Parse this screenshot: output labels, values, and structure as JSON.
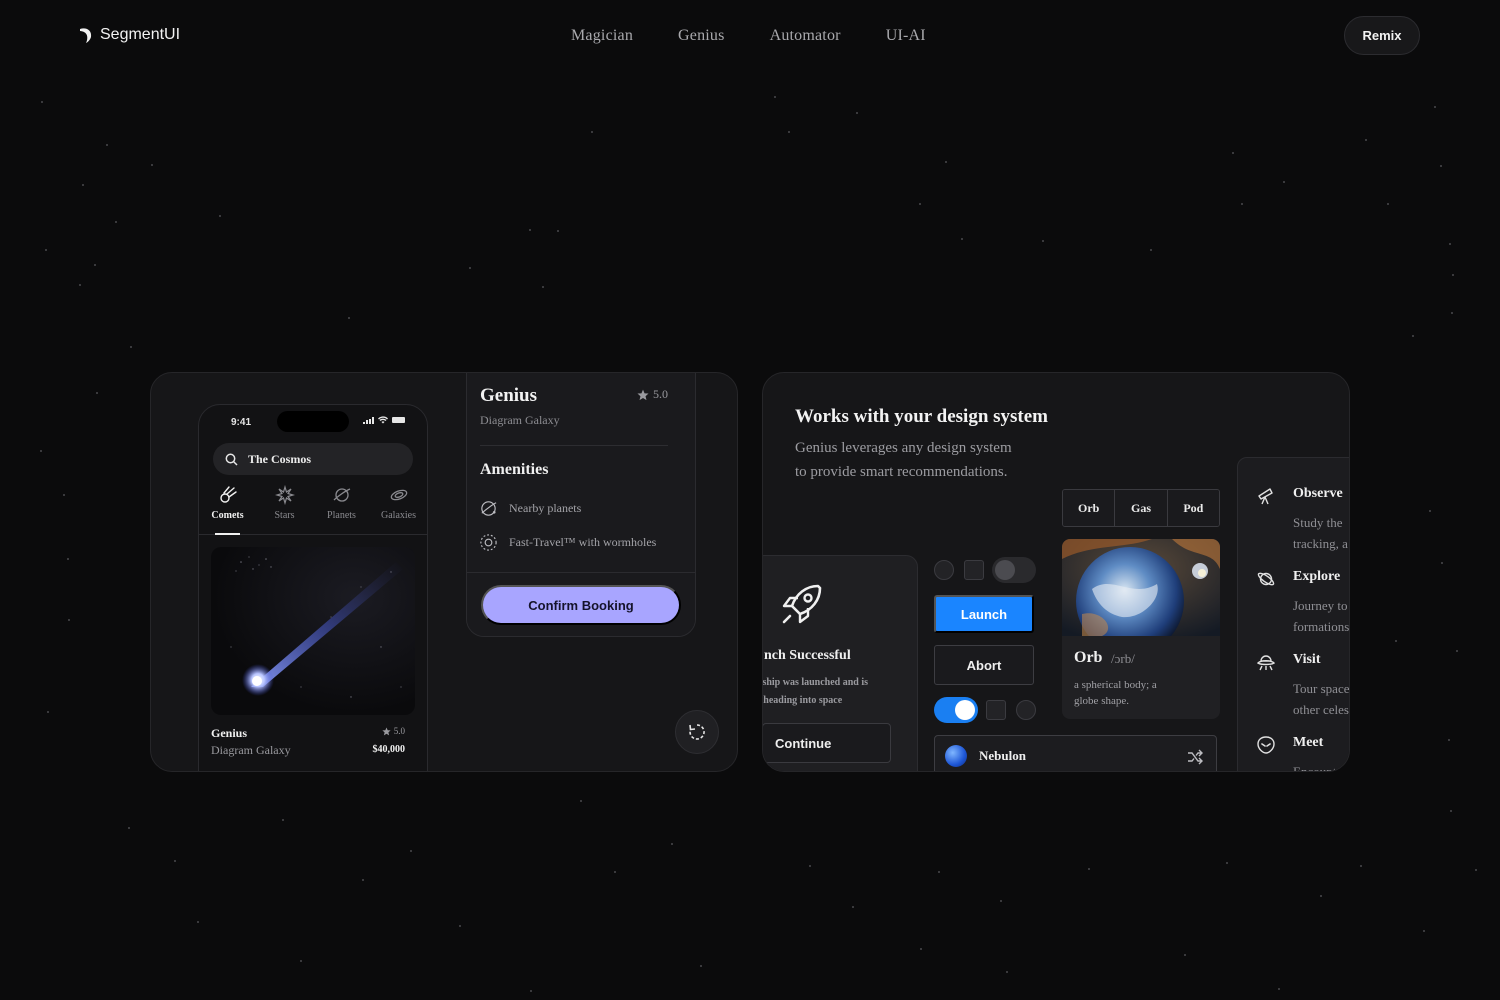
{
  "brand": {
    "name": "SegmentUI"
  },
  "nav": {
    "links": [
      "Magician",
      "Genius",
      "Automator",
      "UI-AI"
    ],
    "cta": "Remix"
  },
  "phone": {
    "time": "9:41",
    "search": "The Cosmos",
    "categories": [
      {
        "label": "Comets",
        "icon": "comet-icon",
        "active": true
      },
      {
        "label": "Stars",
        "icon": "star-burst-icon",
        "active": false
      },
      {
        "label": "Planets",
        "icon": "planet-icon",
        "active": false
      },
      {
        "label": "Galaxies",
        "icon": "galaxy-icon",
        "active": false
      }
    ],
    "listing": {
      "title": "Genius",
      "subtitle": "Diagram Galaxy",
      "rating": "5.0",
      "price": "$40,000"
    }
  },
  "booking": {
    "title": "Genius",
    "rating": "5.0",
    "subtitle": "Diagram Galaxy",
    "amenities_heading": "Amenities",
    "amenities": [
      {
        "label": "Nearby planets",
        "icon": "orbit-planet-icon"
      },
      {
        "label": "Fast-Travel™ with wormholes",
        "icon": "wormhole-icon"
      }
    ],
    "confirm": "Confirm Booking",
    "accent": "#a8a5ff"
  },
  "design": {
    "title": "Works with your design system",
    "desc_line1": "Genius leverages any design system",
    "desc_line2": "to provide smart recommendations.",
    "launch": {
      "title": "nch Successful",
      "text_line1": "eship was launched and is",
      "text_line2": "/ heading into space",
      "continue": "Continue"
    },
    "buttons": {
      "launch": "Launch",
      "abort": "Abort",
      "launch_color": "#1a85ff"
    },
    "segments": [
      "Orb",
      "Gas",
      "Pod"
    ],
    "orb": {
      "word": "Orb",
      "pronunciation": "/ɔrb/",
      "definition_line1": "a spherical body; a",
      "definition_line2": "globe shape."
    },
    "nebulon": "Nebulon",
    "toggles": {
      "top_toggle_on": false,
      "bottom_toggle_on": true
    },
    "features": [
      {
        "title": "Observe",
        "desc1": "Study the",
        "desc2": "tracking, a",
        "icon": "telescope-icon"
      },
      {
        "title": "Explore",
        "desc1": "Journey to",
        "desc2": "formations",
        "icon": "planet-ring-icon"
      },
      {
        "title": "Visit",
        "desc1": "Tour space",
        "desc2": "other celes",
        "icon": "ufo-icon"
      },
      {
        "title": "Meet",
        "desc1": "Encount",
        "desc2": "",
        "icon": "alien-icon"
      }
    ]
  }
}
